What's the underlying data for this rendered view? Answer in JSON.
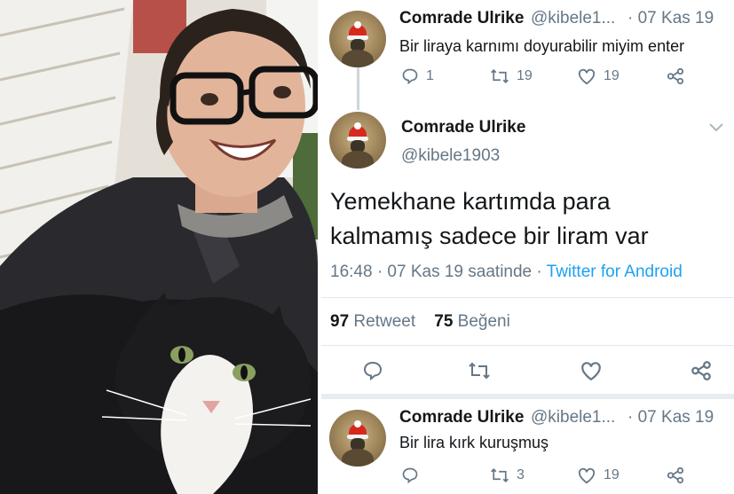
{
  "tweet1": {
    "name": "Comrade Ulrike",
    "handle": "@kibele1...",
    "date": "· 07 Kas 19",
    "text": "Bir liraya karnımı doyurabilir miyim enter",
    "replies": "1",
    "retweets": "19",
    "likes": "19"
  },
  "main_tweet": {
    "name": "Comrade Ulrike",
    "handle": "@kibele1903",
    "line1": "Yemekhane kartımda para",
    "line2": "kalmamış sadece bir liram var",
    "time": "16:48 · 07 Kas 19 saatinde ·",
    "source": "Twitter for Android",
    "retweet_count": "97",
    "retweet_label": "Retweet",
    "like_count": "75",
    "like_label": "Beğeni"
  },
  "tweet3": {
    "name": "Comrade Ulrike",
    "handle": "@kibele1...",
    "date": "· 07 Kas 19",
    "text": "Bir lira kırk kuruşmuş",
    "retweets": "3",
    "likes": "19"
  },
  "icons": [
    "reply-icon",
    "retweet-icon",
    "like-icon",
    "share-icon",
    "caret-icon"
  ],
  "colors": {
    "link": "#1da1f2",
    "muted": "#657786",
    "text": "#14171a"
  }
}
